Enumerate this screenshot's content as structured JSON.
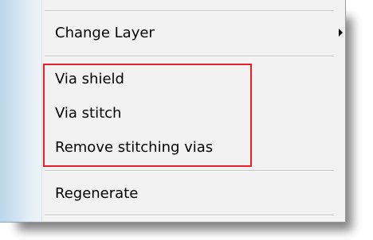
{
  "menu": {
    "items": [
      {
        "label": "Change Layer",
        "has_submenu": true,
        "submenu_icon": "chevron-right-icon"
      },
      {
        "label": "Via shield"
      },
      {
        "label": "Via stitch"
      },
      {
        "label": "Remove stitching vias"
      },
      {
        "label": "Regenerate"
      }
    ]
  },
  "annotation": {
    "highlight_color": "#e8202a"
  },
  "colors": {
    "menu_background": "#f2f2f2",
    "gutter_blue": "#bcd6ea",
    "separator": "#c5c5c5"
  }
}
